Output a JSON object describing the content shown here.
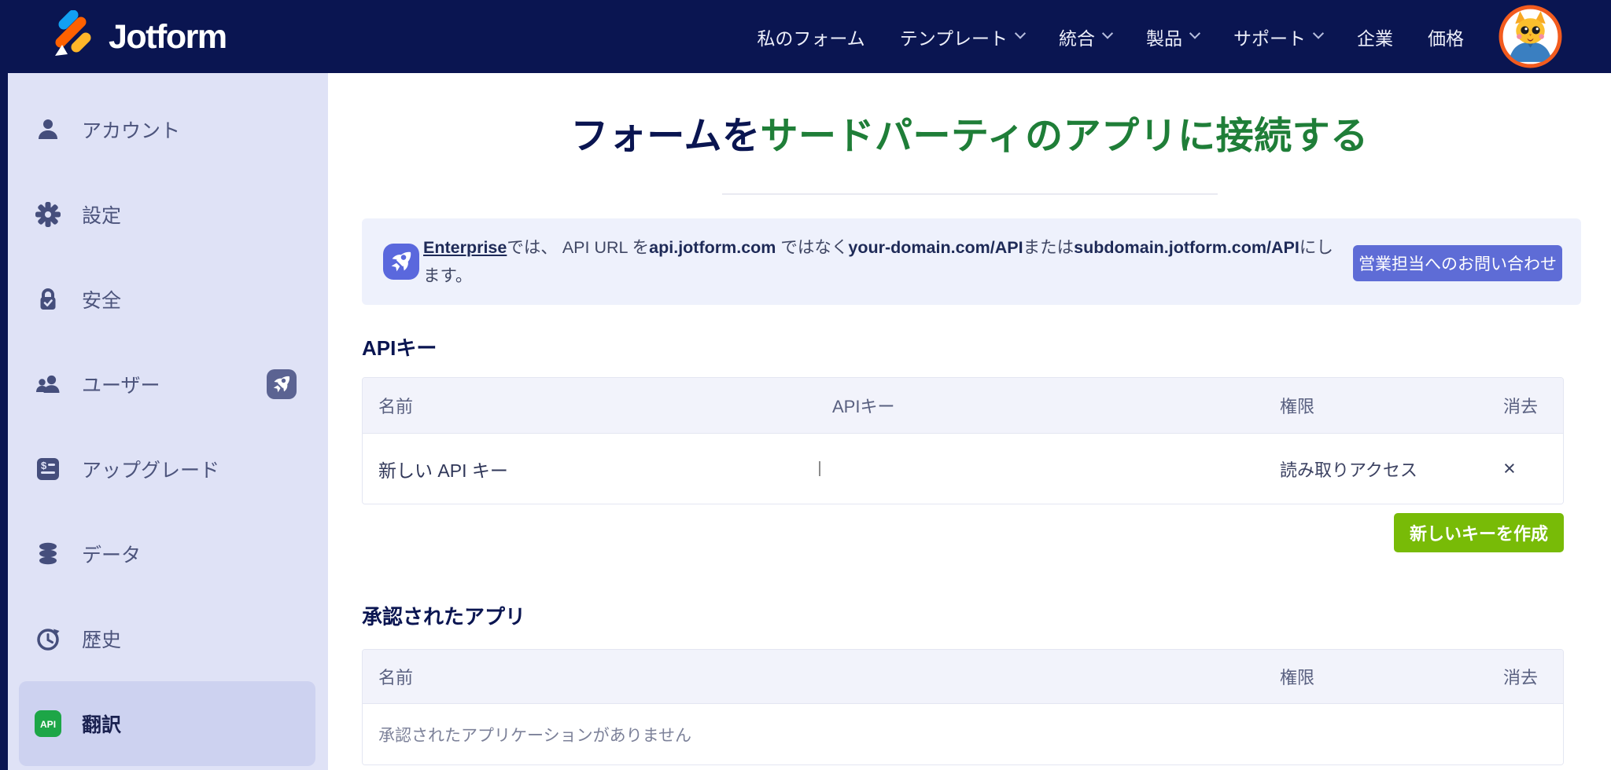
{
  "brand": {
    "name": "Jotform"
  },
  "topnav": {
    "items": [
      {
        "label": "私のフォーム",
        "dropdown": false
      },
      {
        "label": "テンプレート",
        "dropdown": true
      },
      {
        "label": "統合",
        "dropdown": true
      },
      {
        "label": "製品",
        "dropdown": true
      },
      {
        "label": "サポート",
        "dropdown": true
      },
      {
        "label": "企業",
        "dropdown": false
      },
      {
        "label": "価格",
        "dropdown": false
      }
    ]
  },
  "sidebar": {
    "items": [
      {
        "label": "アカウント"
      },
      {
        "label": "設定"
      },
      {
        "label": "安全"
      },
      {
        "label": "ユーザー"
      },
      {
        "label": "アップグレード"
      },
      {
        "label": "データ"
      },
      {
        "label": "歴史"
      },
      {
        "label": "翻訳"
      }
    ],
    "api_badge_text": "API",
    "upgrade_icon_dollar": "$"
  },
  "main": {
    "title": {
      "prefix": "フォームを",
      "highlight": "サードパーティのアプリに接続する"
    },
    "banner": {
      "enterprise": "Enterprise",
      "seg1": "では、 API URL を",
      "bold1": "api.jotform.com",
      "seg2": " ではなく",
      "bold2": "your-domain.com/API",
      "seg3": "または",
      "bold3": "subdomain.jotform.com/API",
      "seg4": "にします。",
      "button": "営業担当へのお問い合わせ"
    },
    "api_keys": {
      "heading": "APIキー",
      "col_name": "名前",
      "col_key": "APIキー",
      "col_perm": "権限",
      "col_delete": "消去",
      "row": {
        "name": "新しい API キー",
        "permission": "読み取りアクセス",
        "delete_symbol": "×"
      },
      "create_button": "新しいキーを作成"
    },
    "authorized_apps": {
      "heading": "承認されたアプリ",
      "col_name": "名前",
      "col_perm": "権限",
      "col_delete": "消去",
      "empty_text": "承認されたアプリケーションがありません"
    }
  },
  "colors": {
    "navbar_navy": "#0a1551",
    "title_green": "#1f7e38",
    "create_button_green": "#78bb07",
    "contact_button_indigo": "#5e6cd6",
    "sidebar_bg": "#dfe2f6",
    "sidebar_active_bg": "#cdd2f0",
    "banner_bg": "#eef1fc",
    "api_badge_green": "#1da647"
  }
}
